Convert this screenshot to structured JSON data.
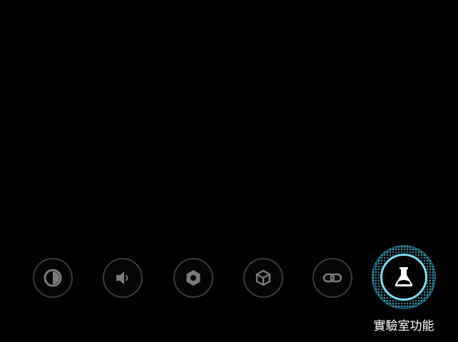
{
  "toolbar": {
    "items": [
      {
        "icon": "contrast-icon",
        "selected": false
      },
      {
        "icon": "volume-icon",
        "selected": false
      },
      {
        "icon": "settings-hex-icon",
        "selected": false
      },
      {
        "icon": "cube-icon",
        "selected": false
      },
      {
        "icon": "link-icon",
        "selected": false
      },
      {
        "icon": "flask-icon",
        "selected": true
      }
    ],
    "selected_label": "實驗室功能"
  },
  "colors": {
    "background": "#000000",
    "icon_inactive": "#7a7a7a",
    "ring_inactive": "#3a3a3a",
    "accent": "#7fdcf2",
    "label": "#ffffff"
  }
}
